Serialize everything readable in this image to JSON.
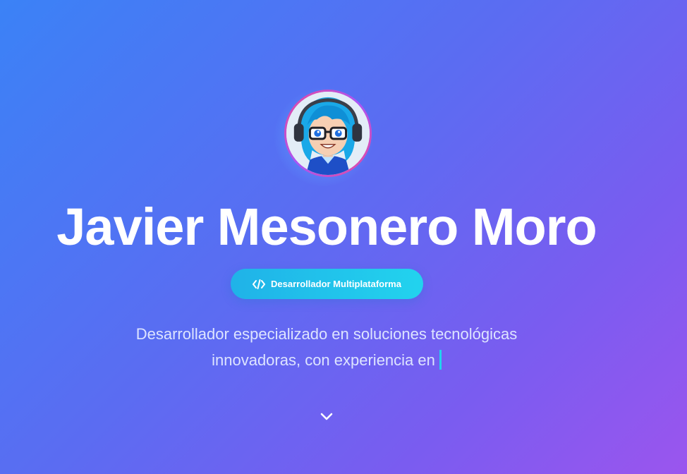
{
  "hero": {
    "name": "Javier Mesonero Moro",
    "role": "Desarrollador Multiplataforma",
    "role_icon": "code-icon",
    "description_line1": "Desarrollador especializado en soluciones tecnológicas",
    "description_line2": "innovadoras, con experiencia en",
    "scroll_icon": "chevron-down-icon"
  },
  "colors": {
    "gradient_start": "#3b82f6",
    "gradient_end": "#9b55ee",
    "badge": "#22d3ee",
    "cursor": "#22d3ee",
    "avatar_ring": "#ec4899"
  }
}
